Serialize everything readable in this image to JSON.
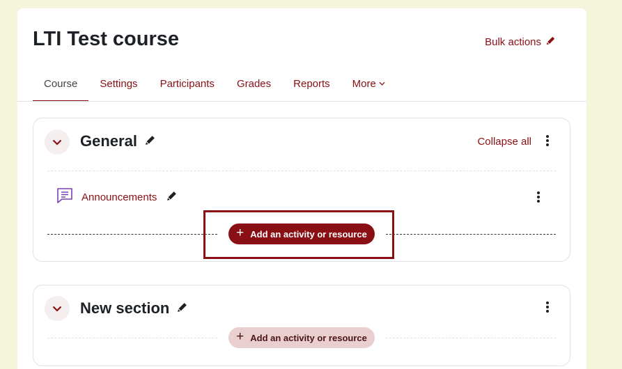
{
  "course": {
    "title": "LTI Test course",
    "bulk_actions_label": "Bulk actions"
  },
  "tabs": [
    {
      "label": "Course",
      "active": true
    },
    {
      "label": "Settings",
      "active": false
    },
    {
      "label": "Participants",
      "active": false
    },
    {
      "label": "Grades",
      "active": false
    },
    {
      "label": "Reports",
      "active": false
    },
    {
      "label": "More",
      "active": false
    }
  ],
  "sections": [
    {
      "title": "General",
      "collapse_all_label": "Collapse all",
      "activities": [
        {
          "name": "Announcements",
          "icon": "forum-icon"
        }
      ],
      "add_label": "Add an activity or resource"
    },
    {
      "title": "New section",
      "add_label": "Add an activity or resource"
    }
  ],
  "colors": {
    "accent": "#8a0f14",
    "page_background": "#f5f5dc",
    "forum_icon": "#7b3fb5",
    "highlight_box": "#8a0f14"
  }
}
